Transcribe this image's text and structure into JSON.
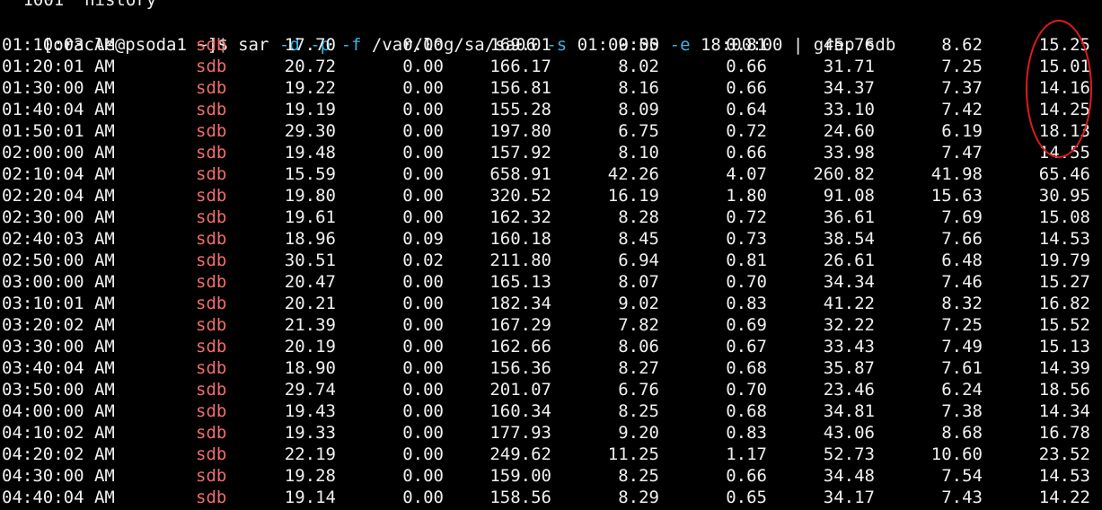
{
  "terminal": {
    "history_text": " 1001  history",
    "prompt": "[oracle@psoda1 ~]$ ",
    "command_parts": [
      {
        "text": "sar ",
        "kind": "cmd"
      },
      {
        "text": "-d",
        "kind": "opt"
      },
      {
        "text": " ",
        "kind": "cmd"
      },
      {
        "text": "-p",
        "kind": "opt"
      },
      {
        "text": " ",
        "kind": "cmd"
      },
      {
        "text": "-f",
        "kind": "opt"
      },
      {
        "text": " /var/log/sa/sa06 ",
        "kind": "cmd"
      },
      {
        "text": "-s",
        "kind": "opt"
      },
      {
        "text": " 01:00:00 ",
        "kind": "cmd"
      },
      {
        "text": "-e",
        "kind": "opt"
      },
      {
        "text": " 18:00:00 | grep sdb",
        "kind": "cmd"
      }
    ],
    "colors": {
      "background": "#000000",
      "text": "#f0f0f0",
      "option": "#3ab4e8",
      "device_highlight": "#f26d6d",
      "annotation_circle": "#e21b1b"
    },
    "rows": [
      [
        "01:10:03 AM",
        "sdb",
        "17.70",
        "0.00",
        "169.01",
        "9.55",
        "0.81",
        "45.76",
        "8.62",
        "15.25"
      ],
      [
        "01:20:01 AM",
        "sdb",
        "20.72",
        "0.00",
        "166.17",
        "8.02",
        "0.66",
        "31.71",
        "7.25",
        "15.01"
      ],
      [
        "01:30:00 AM",
        "sdb",
        "19.22",
        "0.00",
        "156.81",
        "8.16",
        "0.66",
        "34.37",
        "7.37",
        "14.16"
      ],
      [
        "01:40:04 AM",
        "sdb",
        "19.19",
        "0.00",
        "155.28",
        "8.09",
        "0.64",
        "33.10",
        "7.42",
        "14.25"
      ],
      [
        "01:50:01 AM",
        "sdb",
        "29.30",
        "0.00",
        "197.80",
        "6.75",
        "0.72",
        "24.60",
        "6.19",
        "18.13"
      ],
      [
        "02:00:00 AM",
        "sdb",
        "19.48",
        "0.00",
        "157.92",
        "8.10",
        "0.66",
        "33.98",
        "7.47",
        "14.55"
      ],
      [
        "02:10:04 AM",
        "sdb",
        "15.59",
        "0.00",
        "658.91",
        "42.26",
        "4.07",
        "260.82",
        "41.98",
        "65.46"
      ],
      [
        "02:20:04 AM",
        "sdb",
        "19.80",
        "0.00",
        "320.52",
        "16.19",
        "1.80",
        "91.08",
        "15.63",
        "30.95"
      ],
      [
        "02:30:00 AM",
        "sdb",
        "19.61",
        "0.00",
        "162.32",
        "8.28",
        "0.72",
        "36.61",
        "7.69",
        "15.08"
      ],
      [
        "02:40:03 AM",
        "sdb",
        "18.96",
        "0.09",
        "160.18",
        "8.45",
        "0.73",
        "38.54",
        "7.66",
        "14.53"
      ],
      [
        "02:50:00 AM",
        "sdb",
        "30.51",
        "0.02",
        "211.80",
        "6.94",
        "0.81",
        "26.61",
        "6.48",
        "19.79"
      ],
      [
        "03:00:00 AM",
        "sdb",
        "20.47",
        "0.00",
        "165.13",
        "8.07",
        "0.70",
        "34.34",
        "7.46",
        "15.27"
      ],
      [
        "03:10:01 AM",
        "sdb",
        "20.21",
        "0.00",
        "182.34",
        "9.02",
        "0.83",
        "41.22",
        "8.32",
        "16.82"
      ],
      [
        "03:20:02 AM",
        "sdb",
        "21.39",
        "0.00",
        "167.29",
        "7.82",
        "0.69",
        "32.22",
        "7.25",
        "15.52"
      ],
      [
        "03:30:00 AM",
        "sdb",
        "20.19",
        "0.00",
        "162.66",
        "8.06",
        "0.67",
        "33.43",
        "7.49",
        "15.13"
      ],
      [
        "03:40:04 AM",
        "sdb",
        "18.90",
        "0.00",
        "156.36",
        "8.27",
        "0.68",
        "35.87",
        "7.61",
        "14.39"
      ],
      [
        "03:50:00 AM",
        "sdb",
        "29.74",
        "0.00",
        "201.07",
        "6.76",
        "0.70",
        "23.46",
        "6.24",
        "18.56"
      ],
      [
        "04:00:00 AM",
        "sdb",
        "19.43",
        "0.00",
        "160.34",
        "8.25",
        "0.68",
        "34.81",
        "7.38",
        "14.34"
      ],
      [
        "04:10:02 AM",
        "sdb",
        "19.33",
        "0.00",
        "177.93",
        "9.20",
        "0.83",
        "43.06",
        "8.68",
        "16.78"
      ],
      [
        "04:20:02 AM",
        "sdb",
        "22.19",
        "0.00",
        "249.62",
        "11.25",
        "1.17",
        "52.73",
        "10.60",
        "23.52"
      ],
      [
        "04:30:00 AM",
        "sdb",
        "19.28",
        "0.00",
        "159.00",
        "8.25",
        "0.66",
        "34.48",
        "7.54",
        "14.53"
      ],
      [
        "04:40:04 AM",
        "sdb",
        "19.14",
        "0.00",
        "158.56",
        "8.29",
        "0.65",
        "34.17",
        "7.43",
        "14.22"
      ]
    ]
  }
}
